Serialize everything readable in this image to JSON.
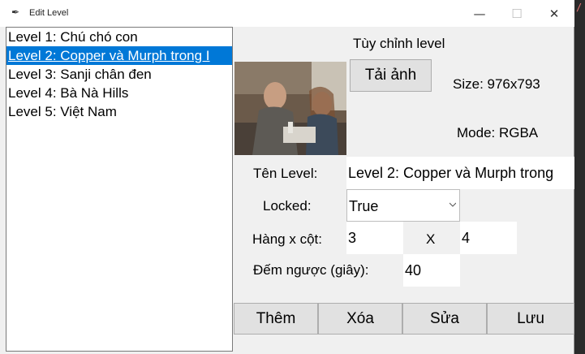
{
  "window": {
    "title": "Edit Level",
    "minimize": "—",
    "maximize": "☐",
    "close": "✕"
  },
  "levels": [
    "Level 1: Chú chó con",
    "Level 2: Copper và Murph trong I",
    "Level 3: Sanji chân đen",
    "Level 4: Bà Nà Hills",
    "Level 5: Việt Nam"
  ],
  "selected_index": 1,
  "editor": {
    "heading": "Tùy chỉnh level",
    "upload_label": "Tải ảnh",
    "size_text": "Size: 976x793",
    "mode_text": "Mode: RGBA",
    "name_label": "Tên Level:",
    "name_value": "Level 2: Copper và Murph trong",
    "locked_label": "Locked:",
    "locked_value": "True",
    "grid_label": "Hàng x cột:",
    "rows_value": "3",
    "x_label": "X",
    "cols_value": "4",
    "countdown_label": "Đếm ngược (giây):",
    "countdown_value": "40"
  },
  "buttons": {
    "add": "Thêm",
    "delete": "Xóa",
    "edit": "Sửa",
    "save": "Lưu"
  },
  "colors": {
    "selection": "#0078d7",
    "window_bg": "#f0f0f0"
  }
}
